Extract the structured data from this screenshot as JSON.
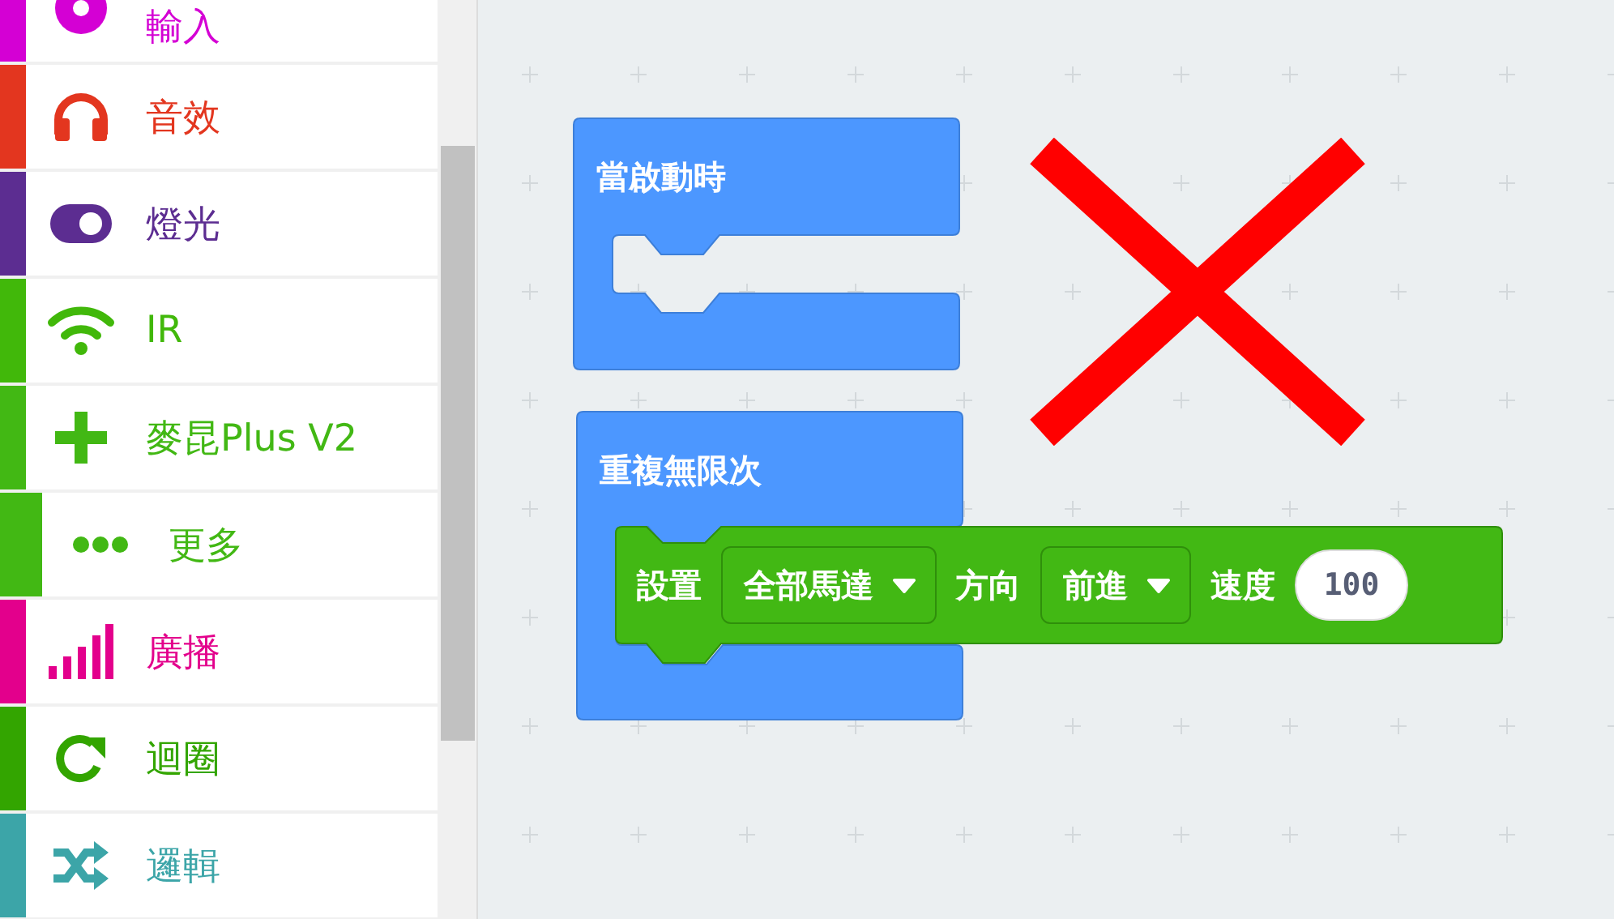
{
  "sidebar": {
    "items": [
      {
        "kind": "category",
        "label": "輸入",
        "color": "#d400d4"
      },
      {
        "kind": "category",
        "label": "音效",
        "color": "#e3361f"
      },
      {
        "kind": "category",
        "label": "燈光",
        "color": "#5c2d91"
      },
      {
        "kind": "category",
        "label": "IR",
        "color": "#41b80a"
      },
      {
        "kind": "category",
        "label": "麥昆Plus V2",
        "color": "#42b814"
      },
      {
        "kind": "subcategory",
        "label": "更多",
        "color": "#42b814"
      },
      {
        "kind": "category",
        "label": "廣播",
        "color": "#e3008c"
      },
      {
        "kind": "category",
        "label": "迴圈",
        "color": "#33a500"
      },
      {
        "kind": "category",
        "label": "邏輯",
        "color": "#3ca5a8"
      }
    ]
  },
  "workspace": {
    "blocks": [
      {
        "kind": "event",
        "label": "當啟動時"
      },
      {
        "kind": "loop",
        "label": "重複無限次",
        "children": [
          {
            "kind": "statement",
            "parts": [
              {
                "kind": "text",
                "text": "設置"
              },
              {
                "kind": "dropdown",
                "text": "全部馬達"
              },
              {
                "kind": "text",
                "text": "方向"
              },
              {
                "kind": "dropdown",
                "text": "前進"
              },
              {
                "kind": "text",
                "text": "速度"
              },
              {
                "kind": "number",
                "text": "100"
              }
            ]
          }
        ]
      }
    ]
  }
}
